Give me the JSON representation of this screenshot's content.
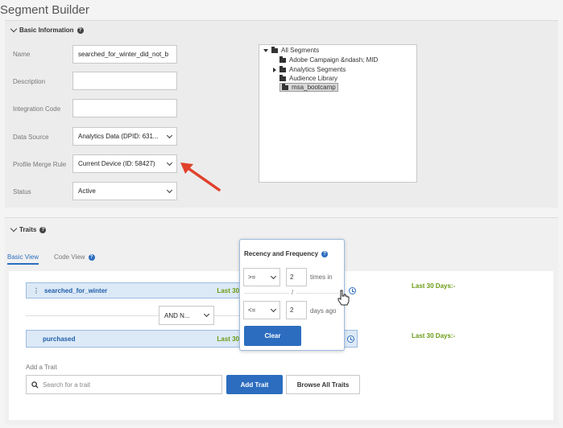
{
  "page": {
    "title": "Segment Builder"
  },
  "basic_info": {
    "heading": "Basic Information",
    "fields": {
      "name": {
        "label": "Name",
        "value": "searched_for_winter_did_not_b"
      },
      "description": {
        "label": "Description",
        "value": ""
      },
      "integration_code": {
        "label": "Integration Code",
        "value": ""
      },
      "data_source": {
        "label": "Data Source",
        "value": "Analytics Data (DPID: 631..."
      },
      "profile_merge_rule": {
        "label": "Profile Merge Rule",
        "value": "Current Device (ID: 58427)"
      },
      "status": {
        "label": "Status",
        "value": "Active"
      }
    },
    "tree": {
      "root": "All Segments",
      "items": [
        "Adobe Campaign &ndash; MID",
        "Analytics Segments",
        "Audience Library",
        "msa_bootcamp"
      ]
    }
  },
  "traits": {
    "heading": "Traits",
    "tabs": {
      "basic": "Basic View",
      "code": "Code View"
    },
    "rows": [
      {
        "name": "searched_for_winter",
        "partial_last": "Last 30",
        "recency": "Last 30 Days:-"
      },
      {
        "name": "purchased",
        "partial_last": "Last 30",
        "recency": "Last 30 Days:-"
      }
    ],
    "operator": "AND N...",
    "add_trait_label": "Add a Trait",
    "search_placeholder": "Search for a trait",
    "add_button": "Add Trait",
    "browse_button": "Browse All Traits"
  },
  "popover": {
    "title": "Recency and Frequency",
    "freq_op": ">=",
    "freq_value": "2",
    "freq_unit": "times in",
    "divider": "/",
    "days_op": "<=",
    "days_value": "2",
    "days_unit": "days ago",
    "clear": "Clear"
  },
  "colors": {
    "accent": "#2c6dbf",
    "recency_green": "#6a9b15",
    "arrow_red": "#e0412b"
  }
}
